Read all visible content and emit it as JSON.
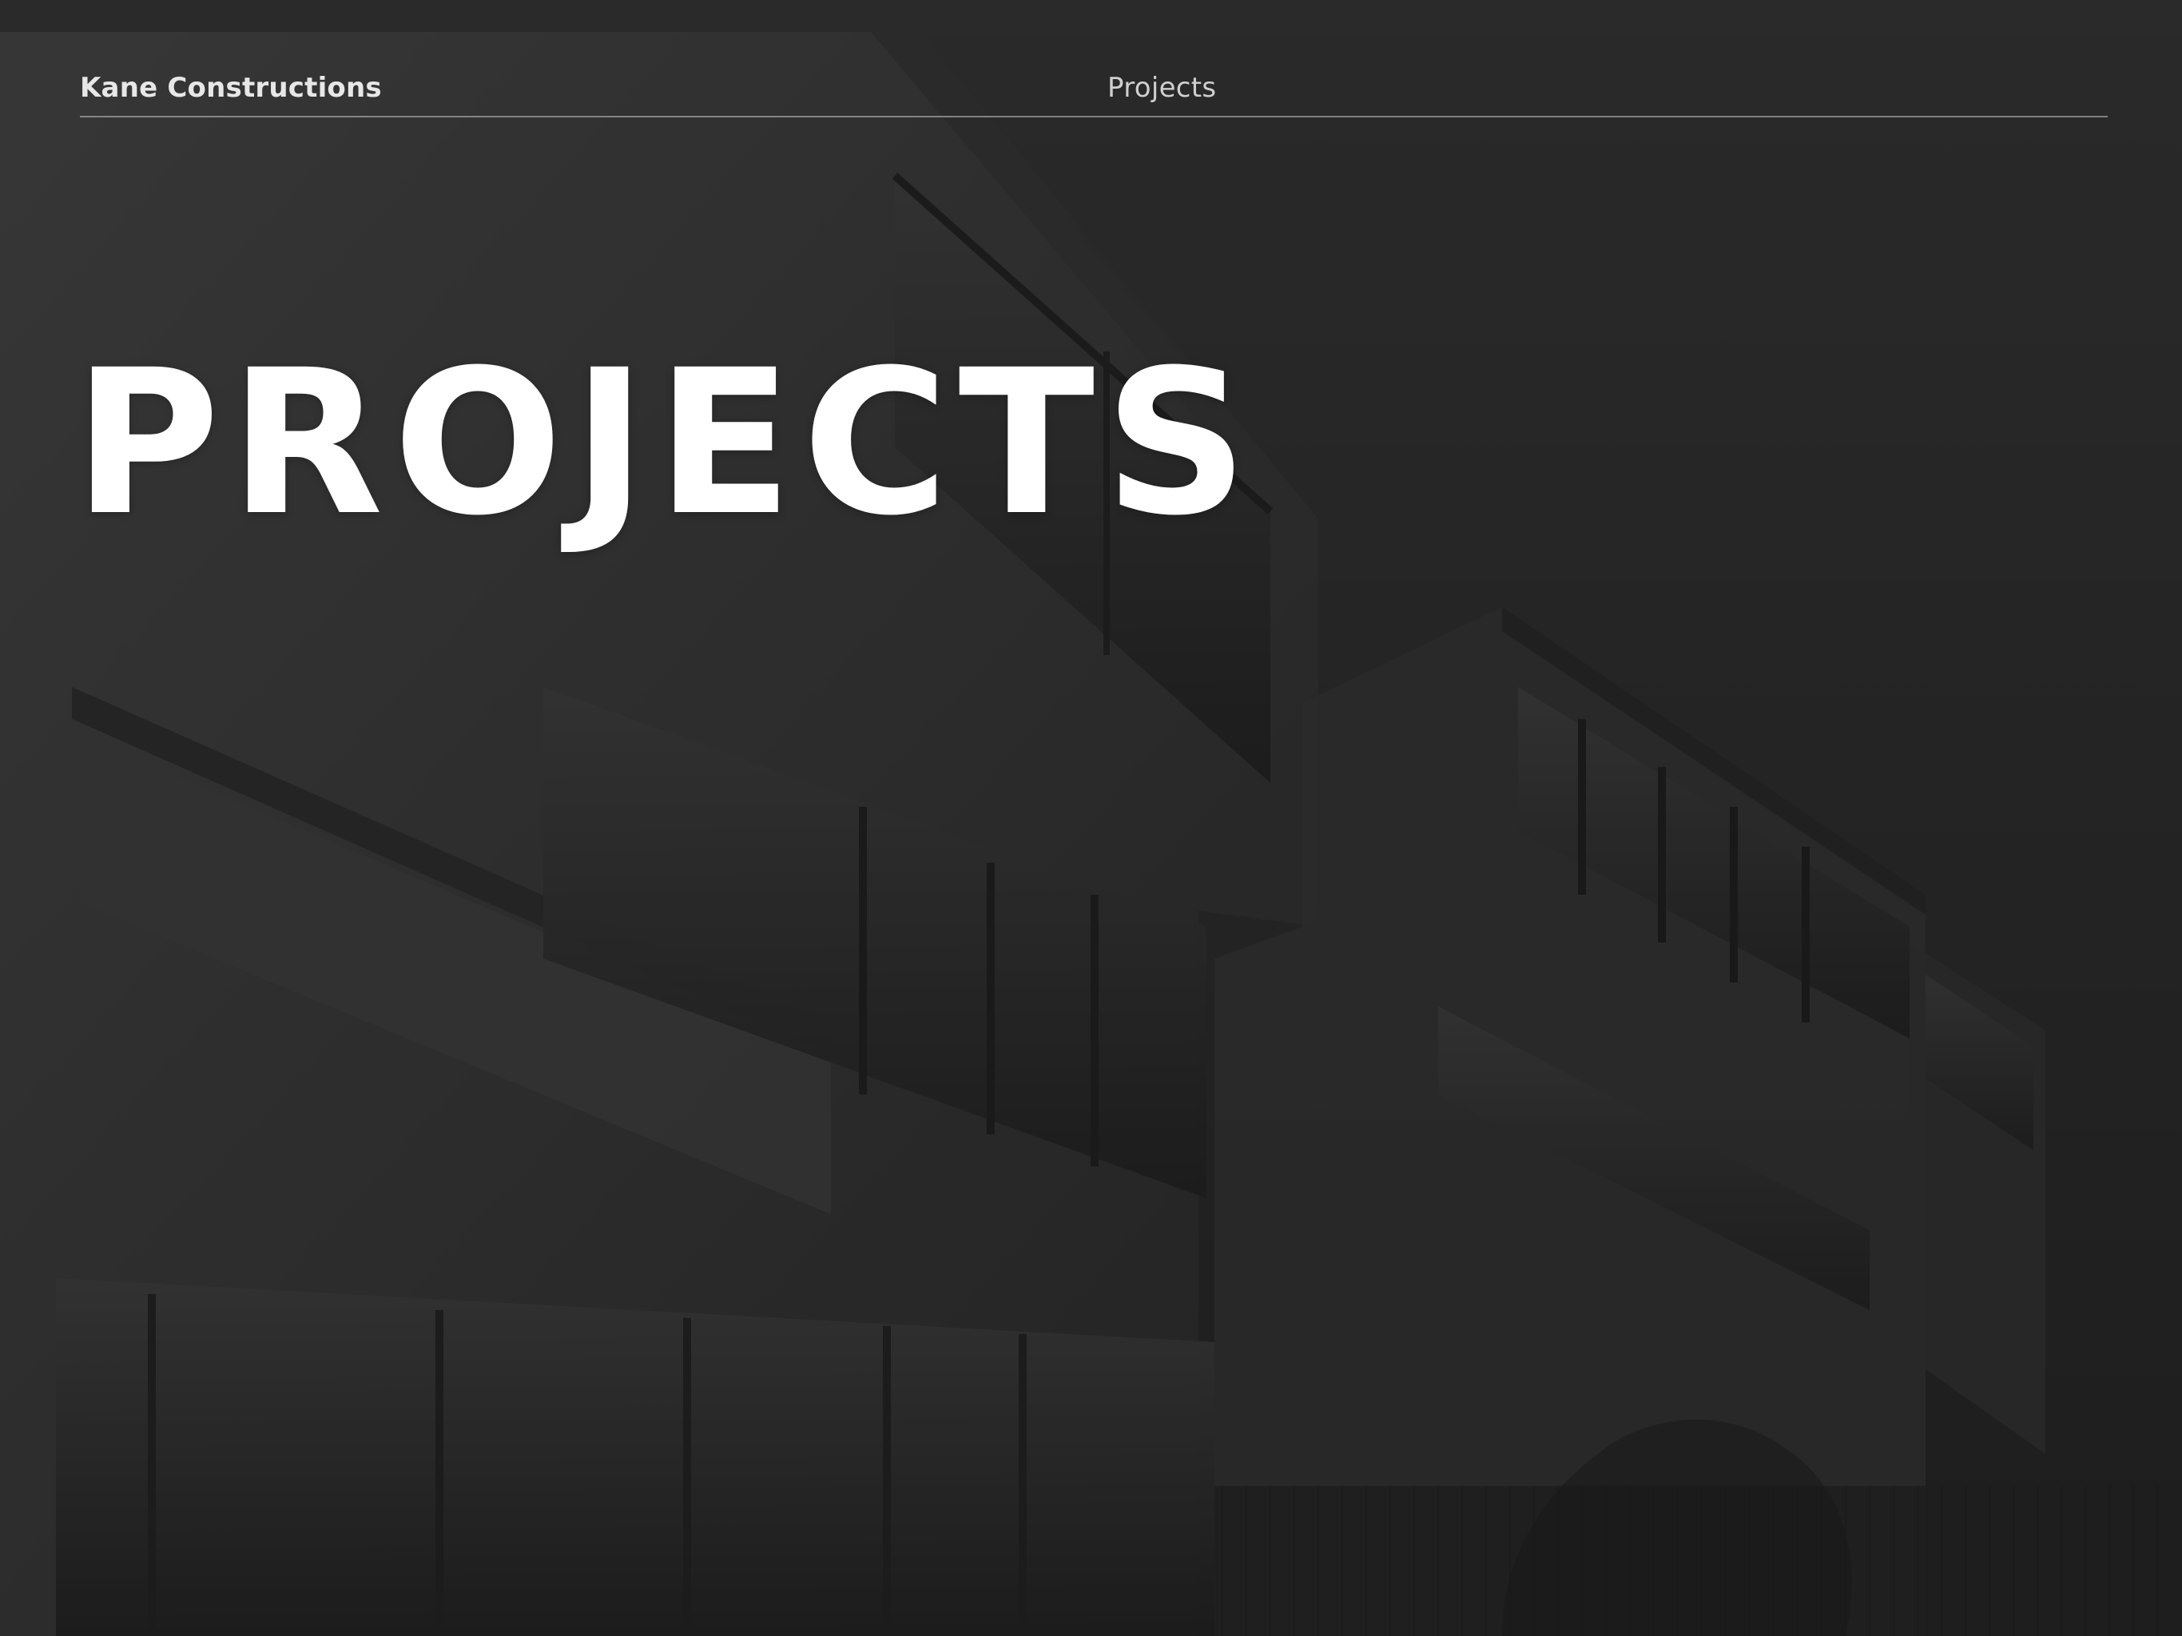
{
  "header": {
    "brand": "Kane Constructions",
    "nav": [
      {
        "label": "Projects"
      }
    ]
  },
  "hero": {
    "title": "PROJECTS"
  },
  "colors": {
    "background": "#2f2f2f",
    "overlay": "rgba(30,30,30,0.55)",
    "text_primary": "#ffffff",
    "text_secondary": "#cfcfcf",
    "divider": "rgba(200,200,200,0.55)"
  }
}
